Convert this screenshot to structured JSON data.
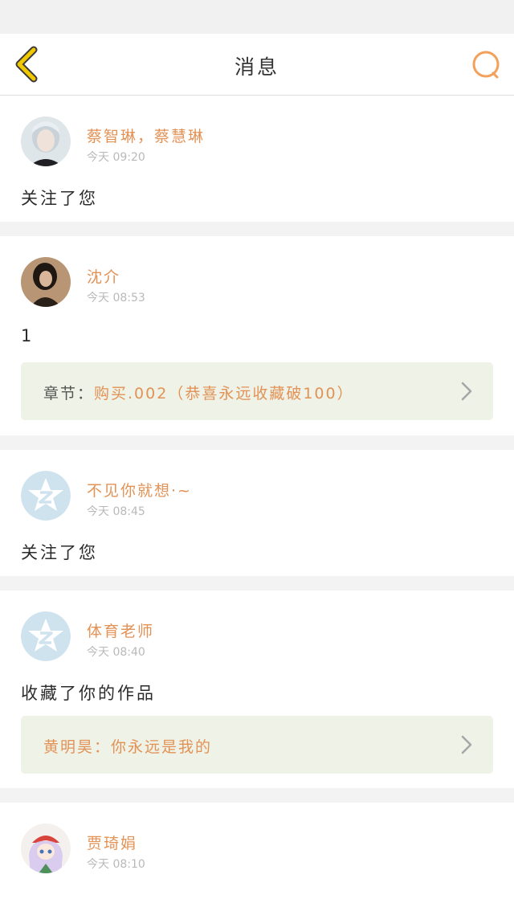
{
  "header": {
    "title": "消息",
    "back_icon": "back-chevron-icon",
    "search_icon": "search-icon",
    "accent": "#f0b400",
    "search_color": "#f3a05a"
  },
  "messages": [
    {
      "name": "蔡智琳，蔡慧琳",
      "time": "今天 09:20",
      "content": "关注了您",
      "avatar": "photo-avatar-silver-hair"
    },
    {
      "name": "沈介",
      "time": "今天 08:53",
      "content": "1",
      "avatar": "photo-avatar-dark",
      "ref": {
        "label": "章节：",
        "value": "购买.002（恭喜永远收藏破100）"
      }
    },
    {
      "name": "不见你就想·~",
      "time": "今天 08:45",
      "content": "关注了您",
      "avatar": "default-q-avatar"
    },
    {
      "name": "体育老师",
      "time": "今天 08:40",
      "content": "收藏了你的作品",
      "avatar": "default-q-avatar",
      "ref": {
        "text": "黄明昊：你永远是我的"
      }
    },
    {
      "name": "贾琦娟",
      "time": "今天 08:10",
      "avatar": "anime-avatar"
    }
  ],
  "colors": {
    "name": "#e39256",
    "time": "#b9b9b9",
    "ref_bg": "#eef2e7"
  }
}
